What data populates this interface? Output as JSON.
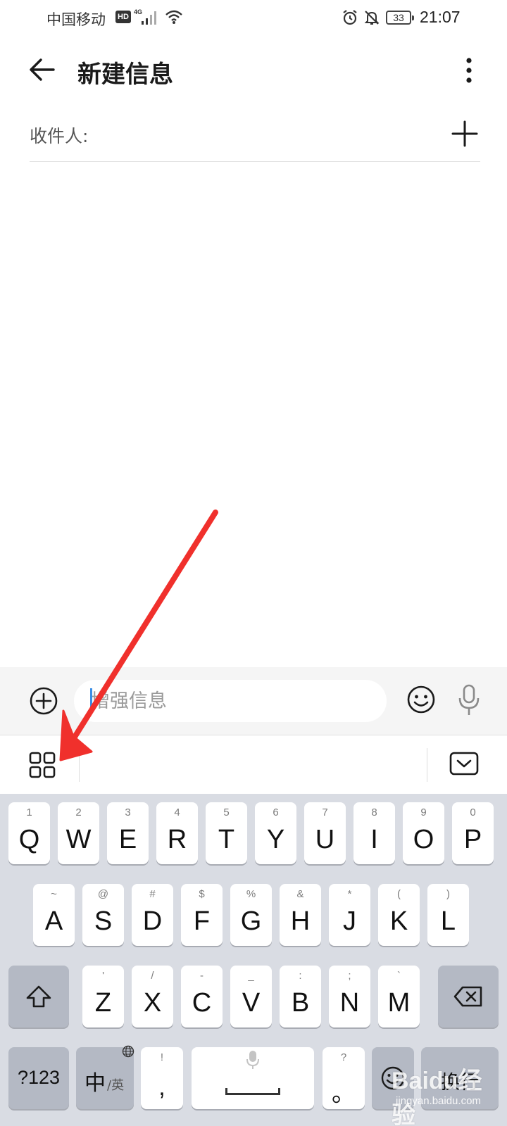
{
  "status_bar": {
    "carrier": "中国移动",
    "hd_badge": "HD",
    "network": "4G",
    "battery_level": "33",
    "time": "21:07"
  },
  "header": {
    "title": "新建信息"
  },
  "recipient": {
    "label": "收件人:"
  },
  "compose": {
    "placeholder": "增强信息"
  },
  "keyboard": {
    "row1": [
      {
        "hint": "1",
        "letter": "Q"
      },
      {
        "hint": "2",
        "letter": "W"
      },
      {
        "hint": "3",
        "letter": "E"
      },
      {
        "hint": "4",
        "letter": "R"
      },
      {
        "hint": "5",
        "letter": "T"
      },
      {
        "hint": "6",
        "letter": "Y"
      },
      {
        "hint": "7",
        "letter": "U"
      },
      {
        "hint": "8",
        "letter": "I"
      },
      {
        "hint": "9",
        "letter": "O"
      },
      {
        "hint": "0",
        "letter": "P"
      }
    ],
    "row2": [
      {
        "hint": "~",
        "letter": "A"
      },
      {
        "hint": "@",
        "letter": "S"
      },
      {
        "hint": "#",
        "letter": "D"
      },
      {
        "hint": "$",
        "letter": "F"
      },
      {
        "hint": "%",
        "letter": "G"
      },
      {
        "hint": "&",
        "letter": "H"
      },
      {
        "hint": "*",
        "letter": "J"
      },
      {
        "hint": "(",
        "letter": "K"
      },
      {
        "hint": ")",
        "letter": "L"
      }
    ],
    "row3": [
      {
        "hint": "'",
        "letter": "Z"
      },
      {
        "hint": "/",
        "letter": "X"
      },
      {
        "hint": "-",
        "letter": "C"
      },
      {
        "hint": "_",
        "letter": "V"
      },
      {
        "hint": ":",
        "letter": "B"
      },
      {
        "hint": ";",
        "letter": "N"
      },
      {
        "hint": "`",
        "letter": "M"
      }
    ],
    "numbers_label": "?123",
    "lang_main": "中",
    "lang_sub": "/英",
    "comma_hint": "!",
    "comma_main": ",",
    "period_hint": "?",
    "period_main": "。",
    "enter_label": "换行"
  },
  "watermark": {
    "brand": "Baidu经验",
    "site": "jingyan.baidu.com"
  },
  "annotation_color": "#f0302c"
}
